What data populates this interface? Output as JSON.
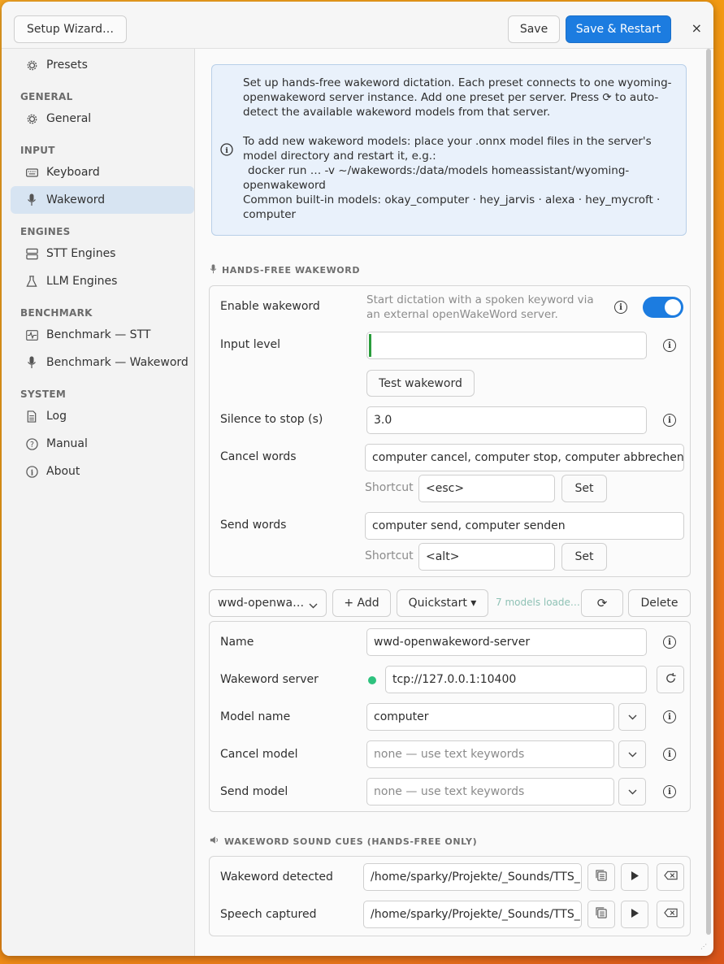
{
  "titlebar": {
    "setup_wizard": "Setup Wizard…",
    "save": "Save",
    "save_restart": "Save & Restart",
    "close": "×"
  },
  "sidebar": {
    "presets": "Presets",
    "general_head": "GENERAL",
    "general": "General",
    "input_head": "INPUT",
    "keyboard": "Keyboard",
    "wakeword": "Wakeword",
    "engines_head": "ENGINES",
    "stt_engines": "STT Engines",
    "llm_engines": "LLM Engines",
    "benchmark_head": "BENCHMARK",
    "bench_stt": "Benchmark — STT",
    "bench_wakeword": "Benchmark — Wakeword",
    "system_head": "SYSTEM",
    "log": "Log",
    "manual": "Manual",
    "about": "About"
  },
  "info": {
    "p1": "Set up hands-free wakeword dictation. Each preset connects to one wyoming-openwakeword server instance. Add one preset per server. Press ⟳ to auto-detect the available wakeword models from that server.",
    "p2a": "To add new wakeword models: place your .onnx model files in the server's model directory and restart it, e.g.:",
    "p2b": "docker run … -v ~/wakewords:/data/models homeassistant/wyoming-openwakeword",
    "p2c": "Common built-in models: okay_computer · hey_jarvis · alexa · hey_mycroft · computer"
  },
  "handsfree": {
    "head": "HANDS-FREE WAKEWORD",
    "enable_label": "Enable wakeword",
    "enable_hint": "Start dictation with a spoken keyword via an external openWakeWord server.",
    "enabled": true,
    "input_level_label": "Input level",
    "input_level": 0.005,
    "test_button": "Test wakeword",
    "silence_label": "Silence to stop (s)",
    "silence_value": "3.0",
    "cancel_label": "Cancel words",
    "cancel_value": "computer cancel, computer stop, computer abbrechen, s",
    "shortcut_label": "Shortcut",
    "cancel_shortcut": "<esc>",
    "set_label": "Set",
    "send_label": "Send words",
    "send_value": "computer send, computer senden",
    "send_shortcut": "<alt>"
  },
  "preset_bar": {
    "preset": "wwd-openwa…",
    "add": "+ Add",
    "quickstart": "Quickstart ▾",
    "status": "7 models loade…",
    "refresh": "⟳",
    "delete": "Delete"
  },
  "preset": {
    "name_label": "Name",
    "name_value": "wwd-openwakeword-server",
    "server_label": "Wakeword server",
    "server_value": "tcp://127.0.0.1:10400",
    "model_label": "Model name",
    "model_value": "computer",
    "cancel_model_label": "Cancel model",
    "cancel_model_placeholder": "none — use text keywords",
    "send_model_label": "Send model",
    "send_model_placeholder": "none — use text keywords"
  },
  "sound": {
    "head": "WAKEWORD SOUND CUES (HANDS-FREE ONLY)",
    "detected_label": "Wakeword detected",
    "detected_value": "/home/sparky/Projekte/_Sounds/TTS_",
    "captured_label": "Speech captured",
    "captured_value": "/home/sparky/Projekte/_Sounds/TTS_"
  },
  "colors": {
    "accent": "#1c7ce0",
    "status_ok": "#2ec27e"
  }
}
